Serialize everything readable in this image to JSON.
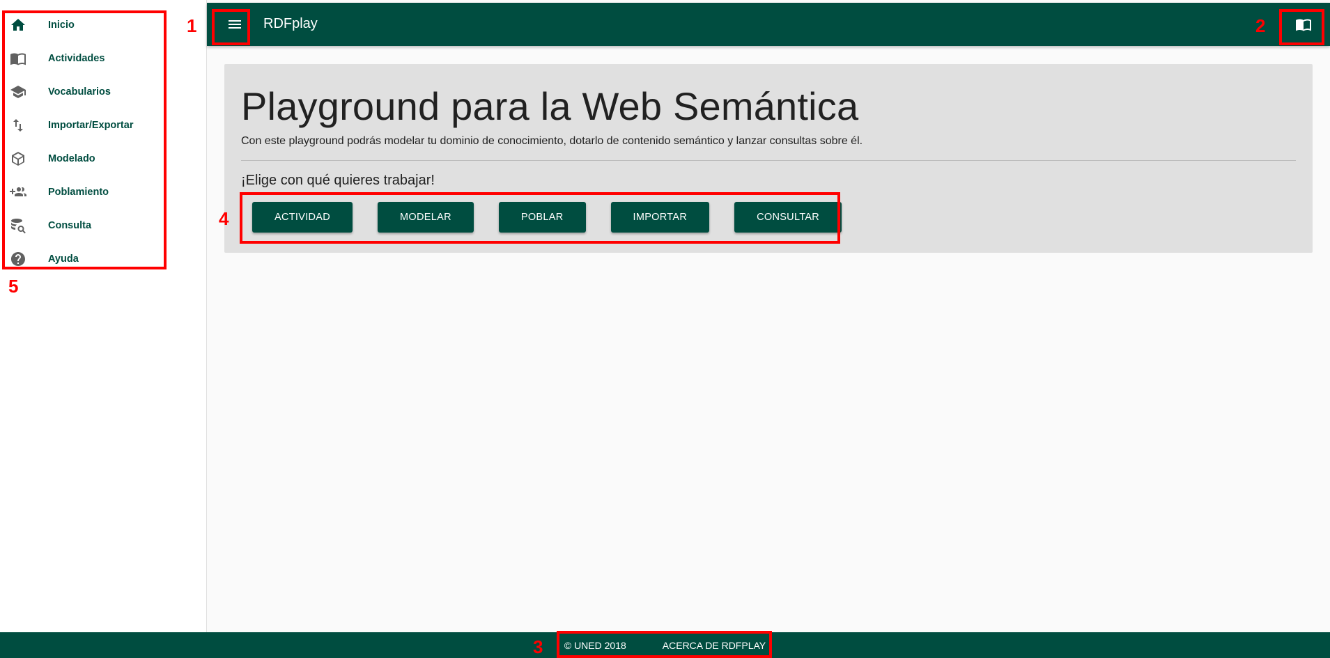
{
  "sidebar": {
    "items": [
      {
        "label": "Inicio",
        "icon": "home-icon"
      },
      {
        "label": "Actividades",
        "icon": "book-open-icon"
      },
      {
        "label": "Vocabularios",
        "icon": "school-icon"
      },
      {
        "label": "Importar/Exportar",
        "icon": "import-export-icon"
      },
      {
        "label": "Modelado",
        "icon": "cube-icon"
      },
      {
        "label": "Poblamiento",
        "icon": "group-add-icon"
      },
      {
        "label": "Consulta",
        "icon": "database-search-icon"
      },
      {
        "label": "Ayuda",
        "icon": "help-icon"
      }
    ]
  },
  "header": {
    "title": "RDFplay",
    "menu_icon": "menu-icon",
    "action_icon": "book-open-icon"
  },
  "hero": {
    "title": "Playground para la Web Semántica",
    "subtitle": "Con este playground podrás modelar tu dominio de conocimiento, dotarlo de contenido semántico y lanzar consultas sobre él.",
    "prompt": "¡Elige con qué quieres trabajar!",
    "buttons": [
      "ACTIVIDAD",
      "MODELAR",
      "POBLAR",
      "IMPORTAR",
      "CONSULTAR"
    ]
  },
  "footer": {
    "copyright": "© UNED 2018",
    "about": "ACERCA DE RDFPLAY"
  },
  "annotations": [
    "1",
    "2",
    "3",
    "4",
    "5"
  ],
  "colors": {
    "primary": "#004d40",
    "hero_bg": "#e0e0e0",
    "annotation": "#ff0000"
  }
}
